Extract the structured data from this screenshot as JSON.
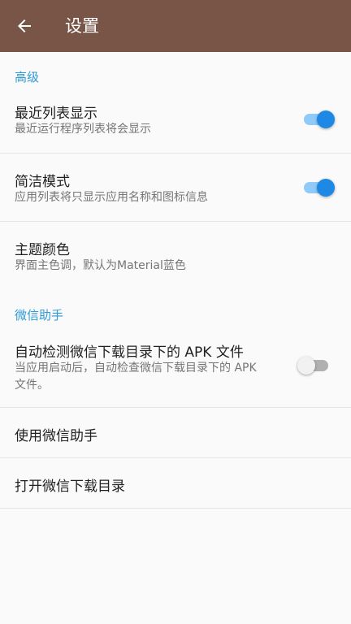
{
  "appbar": {
    "title": "设置",
    "back_icon": "arrow-left-icon",
    "color": "#795548"
  },
  "sections": {
    "advanced": {
      "header": "高级",
      "recent_list": {
        "title": "最近列表显示",
        "summary": "最近运行程序列表将会显示",
        "enabled": true
      },
      "simple_mode": {
        "title": "简洁模式",
        "summary": "应用列表将只显示应用名称和图标信息",
        "enabled": true
      },
      "theme_color": {
        "title": "主题颜色",
        "summary": "界面主色调，默认为Material蓝色"
      }
    },
    "wechat": {
      "header": "微信助手",
      "auto_detect": {
        "title": "自动检测微信下载目录下的 APK 文件",
        "summary": "当应用启动后，自动检查微信下载目录下的 APK 文件。",
        "enabled": false
      },
      "use_helper": {
        "title": "使用微信助手"
      },
      "open_dir": {
        "title": "打开微信下载目录"
      }
    }
  },
  "colors": {
    "accent": "#2e9bd6",
    "switch_on": "#1e88e5"
  }
}
